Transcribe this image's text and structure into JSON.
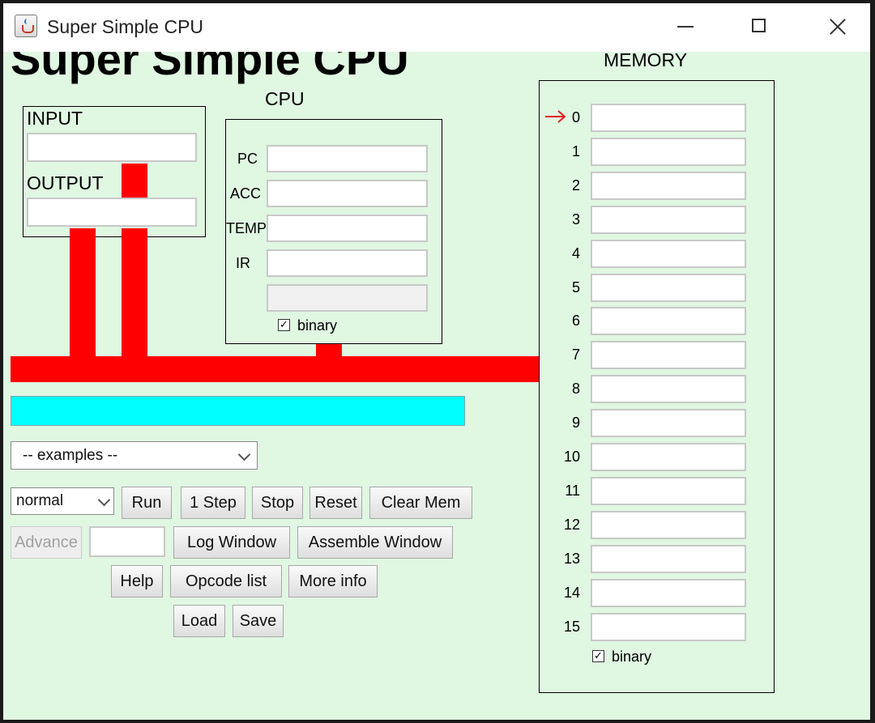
{
  "window": {
    "title": "Super Simple CPU"
  },
  "app": {
    "heading": "Super Simple CPU"
  },
  "io": {
    "input_label": "INPUT",
    "output_label": "OUTPUT",
    "input_value": "",
    "output_value": ""
  },
  "cpu": {
    "label": "CPU",
    "registers": [
      {
        "name": "PC",
        "value": ""
      },
      {
        "name": "ACC",
        "value": ""
      },
      {
        "name": "TEMP",
        "value": ""
      },
      {
        "name": "IR",
        "value": ""
      }
    ],
    "decoded_value": "",
    "binary_label": "binary",
    "binary_checked": true
  },
  "message_bar": {
    "text": "",
    "color": "#00ffff"
  },
  "controls": {
    "examples_select": "-- examples --",
    "speed_select": "normal",
    "run": "Run",
    "step": "1 Step",
    "stop": "Stop",
    "reset": "Reset",
    "clear_mem": "Clear Mem",
    "advance": "Advance",
    "advance_input": "",
    "log_window": "Log Window",
    "assemble_window": "Assemble Window",
    "help": "Help",
    "opcode_list": "Opcode list",
    "more_info": "More info",
    "load": "Load",
    "save": "Save"
  },
  "memory": {
    "label": "MEMORY",
    "pointer_icon": "right-arrow-icon",
    "pointer_color": "#e02020",
    "current_address": 0,
    "cells": [
      {
        "addr": "0",
        "value": ""
      },
      {
        "addr": "1",
        "value": ""
      },
      {
        "addr": "2",
        "value": ""
      },
      {
        "addr": "3",
        "value": ""
      },
      {
        "addr": "4",
        "value": ""
      },
      {
        "addr": "5",
        "value": ""
      },
      {
        "addr": "6",
        "value": ""
      },
      {
        "addr": "7",
        "value": ""
      },
      {
        "addr": "8",
        "value": ""
      },
      {
        "addr": "9",
        "value": ""
      },
      {
        "addr": "10",
        "value": ""
      },
      {
        "addr": "11",
        "value": ""
      },
      {
        "addr": "12",
        "value": ""
      },
      {
        "addr": "13",
        "value": ""
      },
      {
        "addr": "14",
        "value": ""
      },
      {
        "addr": "15",
        "value": ""
      }
    ],
    "binary_label": "binary",
    "binary_checked": true
  },
  "colors": {
    "background": "#e0f7e2",
    "bus": "#ff0000",
    "message_bar": "#00ffff"
  }
}
